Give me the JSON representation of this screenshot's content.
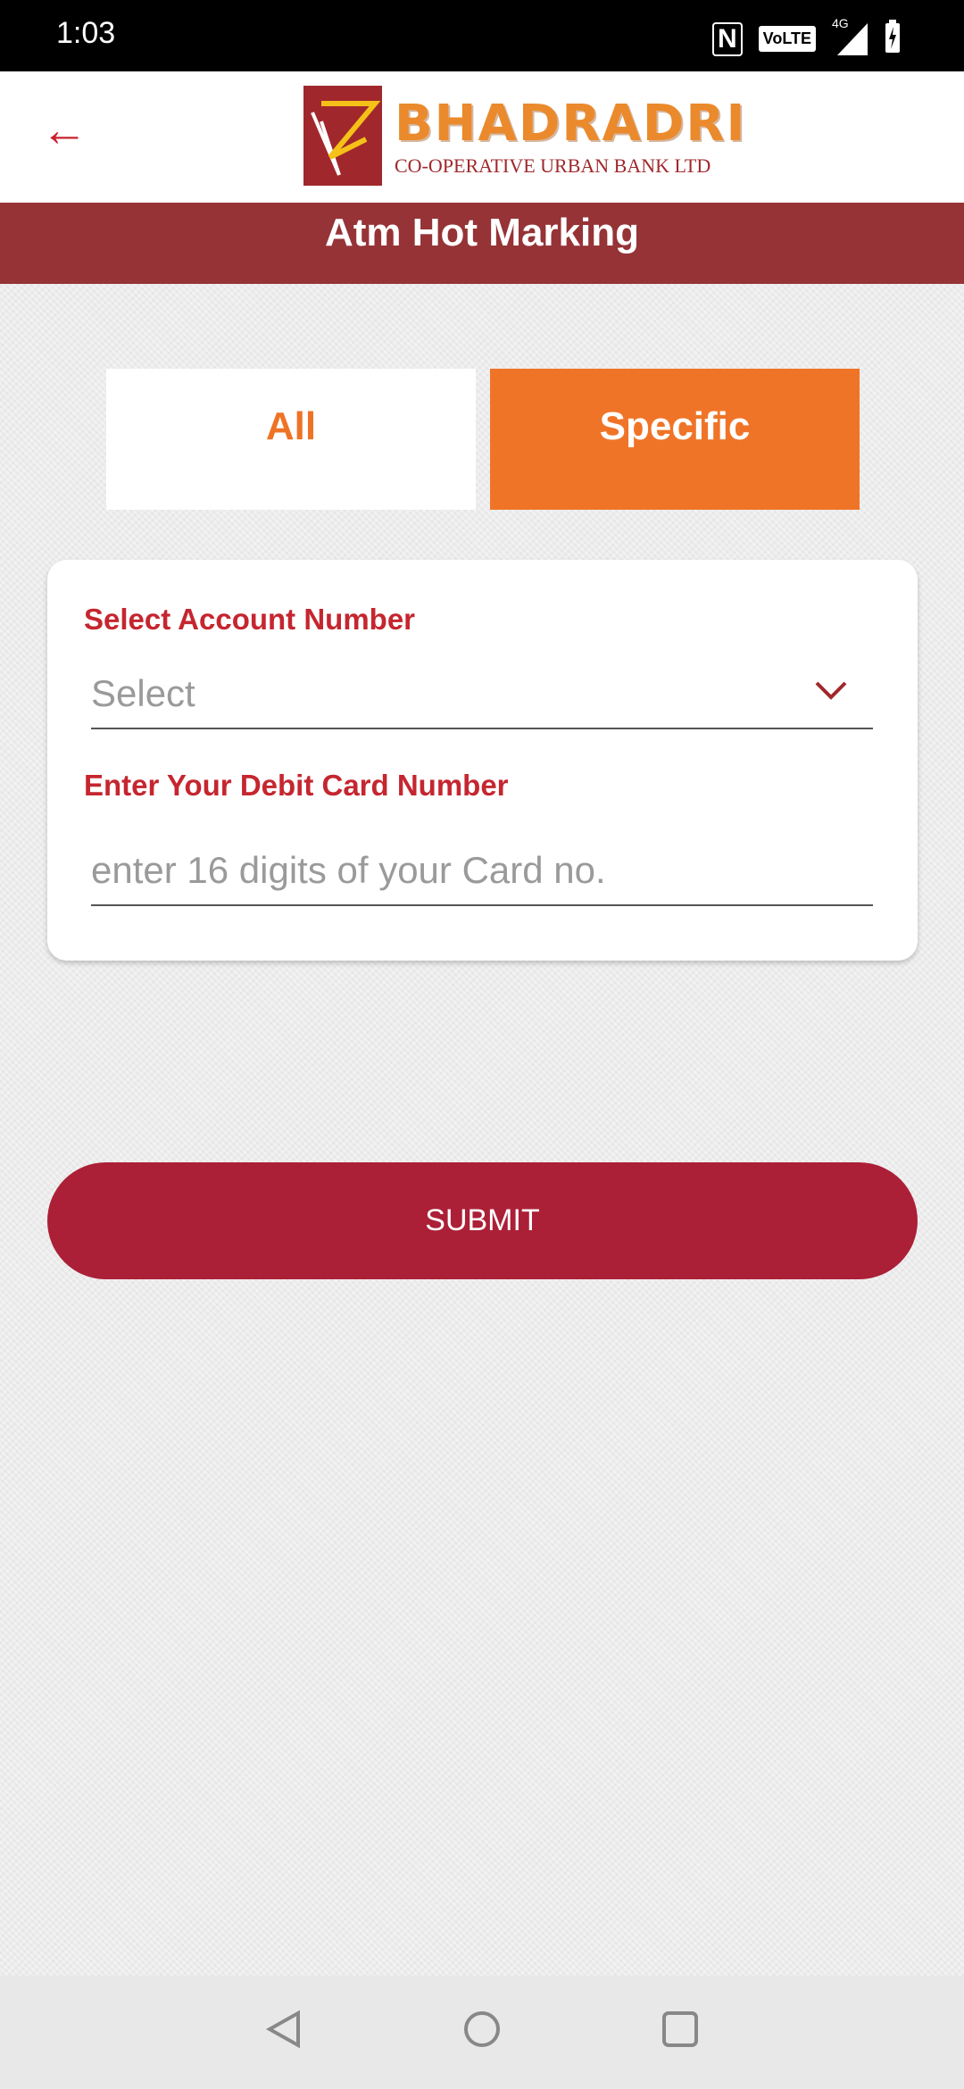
{
  "status_bar": {
    "time": "1:03",
    "volte": "VoLTE",
    "network": "4G"
  },
  "header": {
    "back_icon": "arrow-left-icon",
    "logo_name": "BHADRADRI",
    "logo_sub": "CO-OPERATIVE URBAN BANK LTD"
  },
  "title": "Atm Hot Marking",
  "tabs": [
    {
      "label": "All",
      "selected": false
    },
    {
      "label": "Specific",
      "selected": true
    }
  ],
  "form": {
    "account_label": "Select Account Number",
    "account_value": "Select",
    "card_label": "Enter Your Debit Card Number",
    "card_placeholder": "enter 16 digits of your Card no.",
    "card_value": ""
  },
  "submit_label": "SUBMIT",
  "colors": {
    "title_bar": "#963336",
    "accent": "#f07427",
    "label": "#c5262f",
    "submit": "#ab2037"
  }
}
